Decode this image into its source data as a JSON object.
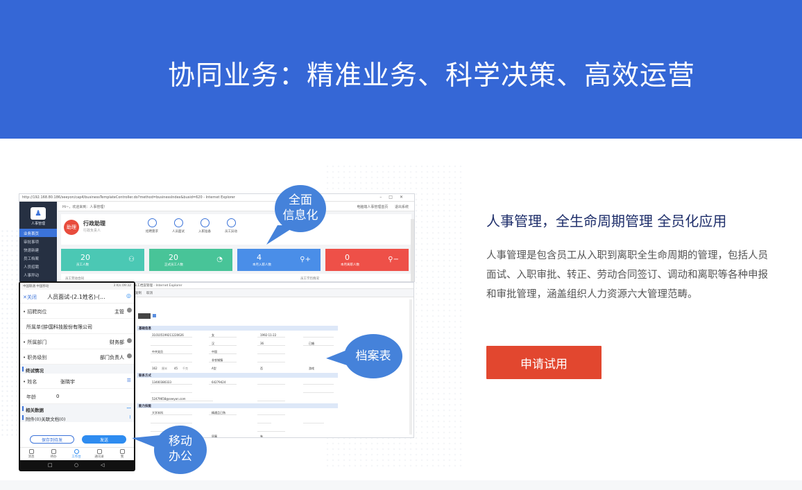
{
  "banner": {
    "title": "协同业务：精准业务、科学决策、高效运营"
  },
  "feature": {
    "title": "人事管理，全生命周期管理 全员化应用",
    "description": "人事管理是包含员工从入职到离职全生命周期的管理，包括人员面试、入职审批、转正、劳动合同签订、调动和离职等各种申报和审批管理，涵盖组织人力资源六大管理范畴。",
    "trial_button": "申请试用"
  },
  "callouts": {
    "top": [
      "全面",
      "信息化"
    ],
    "right": "档案表",
    "bottom": [
      "移动",
      "办公"
    ]
  },
  "desktop": {
    "url": "http://192.168.80.186/seeyon/cap4/businessTemplateController.do?method=businessIndex&busid=620 - Internet Explorer",
    "greeting": "Hi~，欢迎来到：人事管理！",
    "top_right": "电脑端人事管理首页",
    "logout": "退出系统",
    "logo_label": "人事管理",
    "nav": [
      "业务首页",
      "审批事项",
      "快速新建",
      "员工档案",
      "人员招聘",
      "人事异动"
    ],
    "assistant_badge": "助理",
    "assistant_title": "行政助理",
    "assistant_sub": "行政负责人",
    "quick_actions": [
      "招聘需求",
      "人员面试",
      "入职准备",
      "员工异动"
    ],
    "stats": [
      {
        "value": "20",
        "label": "员工人数",
        "color": "#4bc8b4",
        "icon": "users-icon"
      },
      {
        "value": "20",
        "label": "正式员工人数",
        "color": "#48c498",
        "icon": "pie-icon"
      },
      {
        "value": "4",
        "label": "本月入职人数",
        "color": "#4a8ee8",
        "icon": "user-add-icon"
      },
      {
        "value": "0",
        "label": "本月离职人数",
        "color": "#ee5048",
        "icon": "user-remove-icon"
      }
    ],
    "bottom_left": "员工劳动合同",
    "bottom_right": "员工学历情况"
  },
  "form": {
    "title": "员工档案管理 - Internet Explorer",
    "toolbar": [
      "复制",
      "取消"
    ],
    "sections": [
      "基础信息",
      "联系方式",
      "能力技能"
    ],
    "fields": {
      "id_number": "310105199211220626",
      "birthday": "1992-11-22",
      "gender": "女",
      "ethnicity": "汉",
      "nationality": "中国",
      "age": "36",
      "marital": "已婚",
      "politics": "中共党员",
      "hukou": "非农城镇",
      "blood": "A型",
      "height": "162",
      "weight": "45",
      "phone": "13400380333",
      "landline": "64279424",
      "email": "52479658@seeyon.com",
      "education": "大学本科",
      "level": "精通且已熟",
      "unit_cm": "厘米",
      "unit_kg": "千克",
      "sign": "否",
      "hobby": "游戏",
      "relation": "同事",
      "seal": "有"
    }
  },
  "phone": {
    "status_left": "中国联通 中国移动",
    "status_right": "3 K/s  09:32",
    "back": "关闭",
    "title": "人员面试-(2.1姓名)-(...",
    "rows": [
      {
        "label": "招聘岗位",
        "value": "主管",
        "required": true
      },
      {
        "label": "所属单位",
        "value": "中国科技股份有限公司",
        "required": false
      },
      {
        "label": "所属部门",
        "value": "财务部",
        "required": true
      },
      {
        "label": "职务级别",
        "value": "部门负责人",
        "required": true
      }
    ],
    "section_final": "终试情况",
    "name_label": "姓名",
    "name_value": "张晓宇",
    "age_label": "年龄",
    "age_value": "0",
    "related": "相关数据",
    "attachments": "附件(0)关联文档(0)",
    "save_button": "保存到待发",
    "send_button": "发送",
    "tabs": [
      "消息",
      "待办",
      "工作台",
      "通讯录",
      "我"
    ]
  }
}
